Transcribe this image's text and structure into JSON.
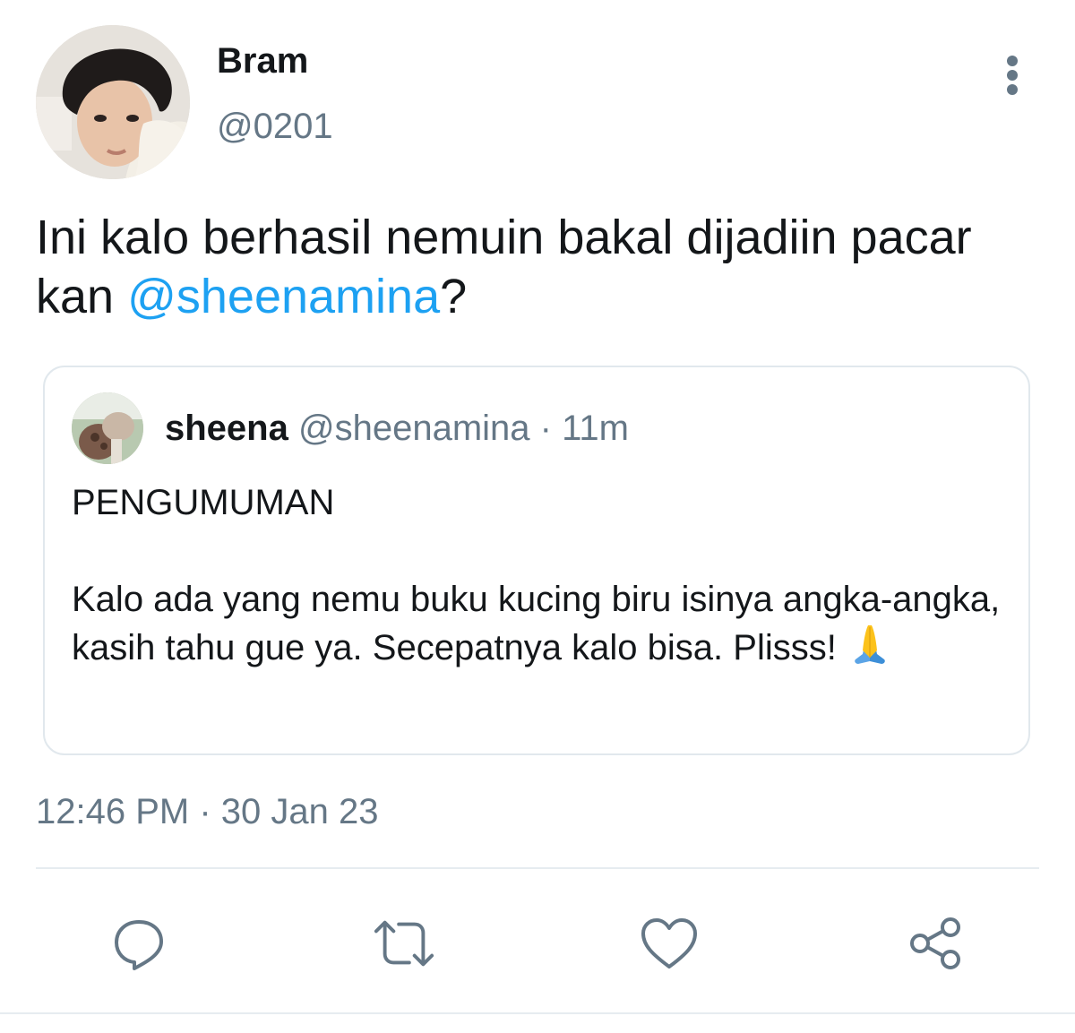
{
  "tweet": {
    "author_name": "Bram",
    "author_handle": "@0201",
    "text_before": "Ini kalo berhasil nemuin bakal dijadiin pacar kan ",
    "mention": "@sheenamina",
    "text_after": "?",
    "timestamp": "12:46 PM · 30 Jan 23"
  },
  "quote": {
    "author_name": "sheena",
    "author_handle": "@sheenamina",
    "time_ago": " · 11m",
    "line1": "PENGUMUMAN",
    "line2": "Kalo ada yang nemu buku kucing biru isinya angka-angka, kasih tahu gue ya. Secepatnya kalo bisa. Plisss! ",
    "emoji_icon": "folded-hands-emoji"
  },
  "actions": [
    {
      "icon": "reply-icon"
    },
    {
      "icon": "retweet-icon"
    },
    {
      "icon": "like-icon"
    },
    {
      "icon": "share-icon"
    }
  ],
  "colors": {
    "text": "#14171a",
    "secondary": "#657786",
    "accent": "#1da1f2",
    "border": "#e1e8ed"
  }
}
